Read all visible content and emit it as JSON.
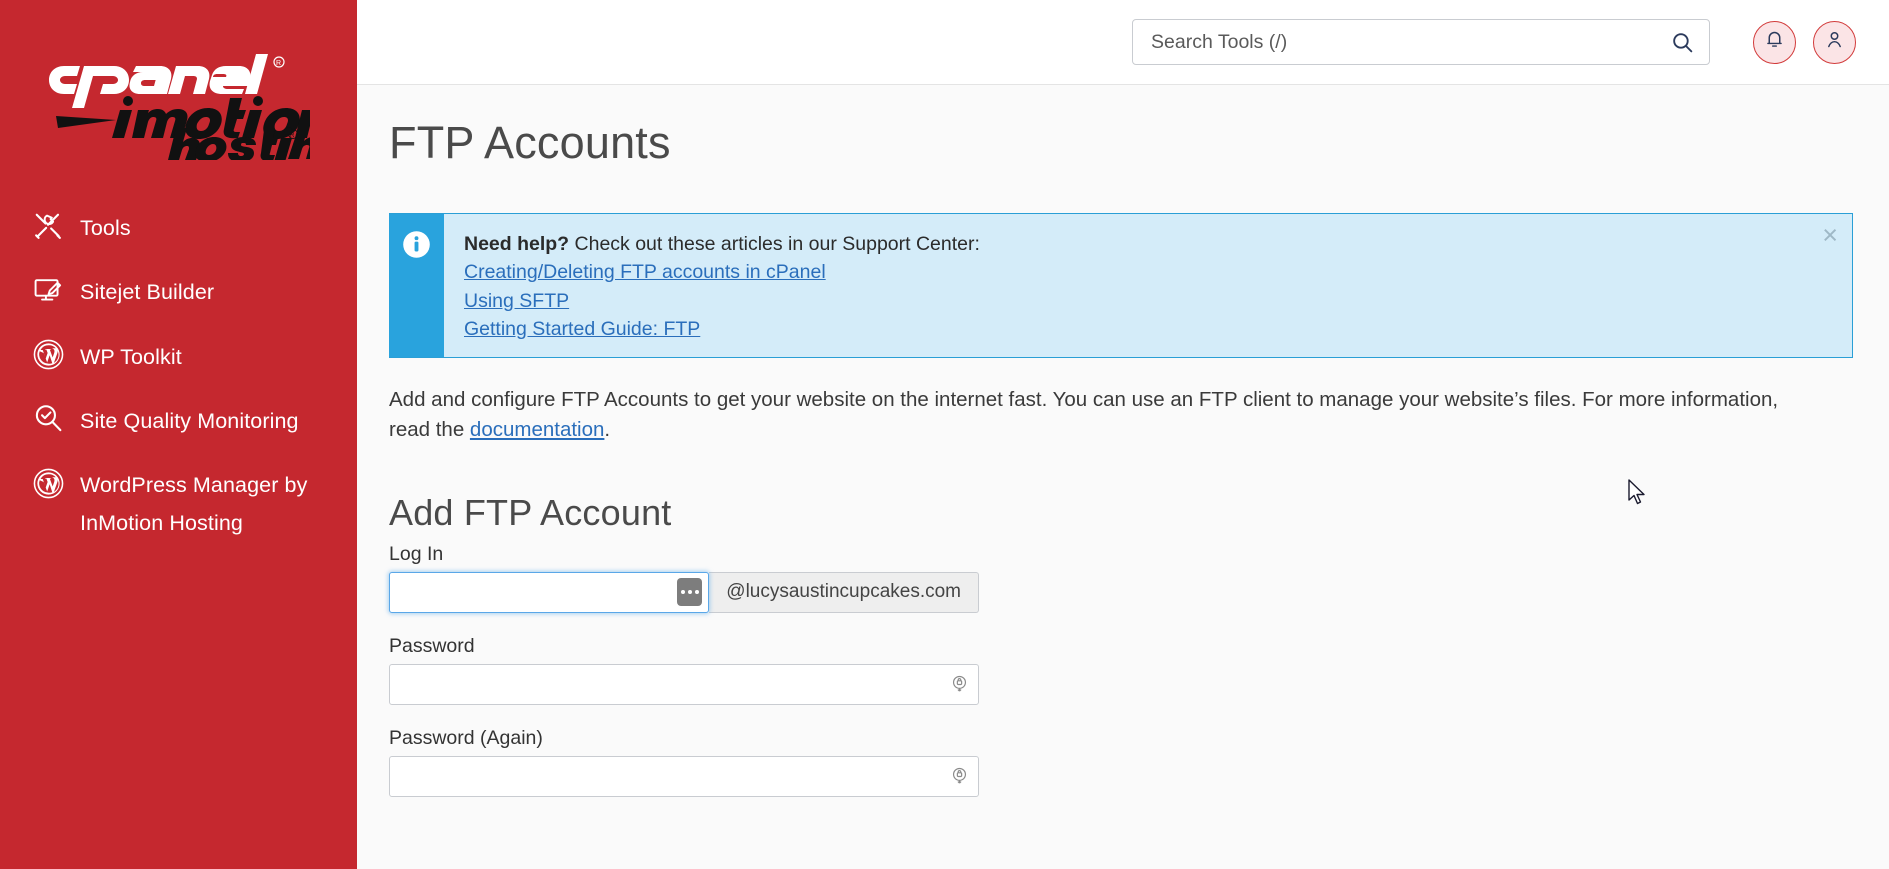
{
  "sidebar": {
    "logo": {
      "brand_top": "cPanel",
      "brand_mid": "inmotion",
      "brand_sub": "hosting"
    },
    "items": [
      {
        "label": "Tools",
        "icon": "tools-icon"
      },
      {
        "label": "Sitejet Builder",
        "icon": "monitor-pencil-icon"
      },
      {
        "label": "WP Toolkit",
        "icon": "wordpress-icon"
      },
      {
        "label": "Site Quality Monitoring",
        "icon": "magnifier-check-icon"
      },
      {
        "label": "WordPress Manager by InMotion Hosting",
        "icon": "wordpress-icon"
      }
    ]
  },
  "header": {
    "search": {
      "placeholder": "Search Tools (/)",
      "value": ""
    },
    "search_icon": "search-icon",
    "notifications_icon": "bell-icon",
    "account_icon": "user-icon"
  },
  "page": {
    "title": "FTP Accounts"
  },
  "alert": {
    "icon": "info-icon",
    "close_label": "×",
    "heading": "Need help?",
    "intro": " Check out these articles in our Support Center:",
    "links": [
      "Creating/Deleting FTP accounts in cPanel",
      "Using SFTP",
      "Getting Started Guide: FTP"
    ]
  },
  "description": {
    "before": "Add and configure FTP Accounts to get your website on the internet fast. You can use an FTP client to manage your website’s files. For more information, read the ",
    "link": "documentation",
    "after": "."
  },
  "form": {
    "title": "Add FTP Account",
    "login": {
      "label": "Log In",
      "value": "",
      "placeholder": "",
      "suffix": "@lucysaustincupcakes.com",
      "generator_icon": "ellipsis-icon"
    },
    "password": {
      "label": "Password",
      "value": "",
      "placeholder": "",
      "icon": "password-lock-icon"
    },
    "password_again": {
      "label": "Password (Again)",
      "value": "",
      "placeholder": "",
      "icon": "password-lock-icon"
    }
  },
  "colors": {
    "sidebar_bg": "#c5282f",
    "alert_bg": "#d4ecf9",
    "alert_accent": "#29a3dd",
    "link": "#2a6ebb",
    "accent_red": "#d23b3b"
  }
}
